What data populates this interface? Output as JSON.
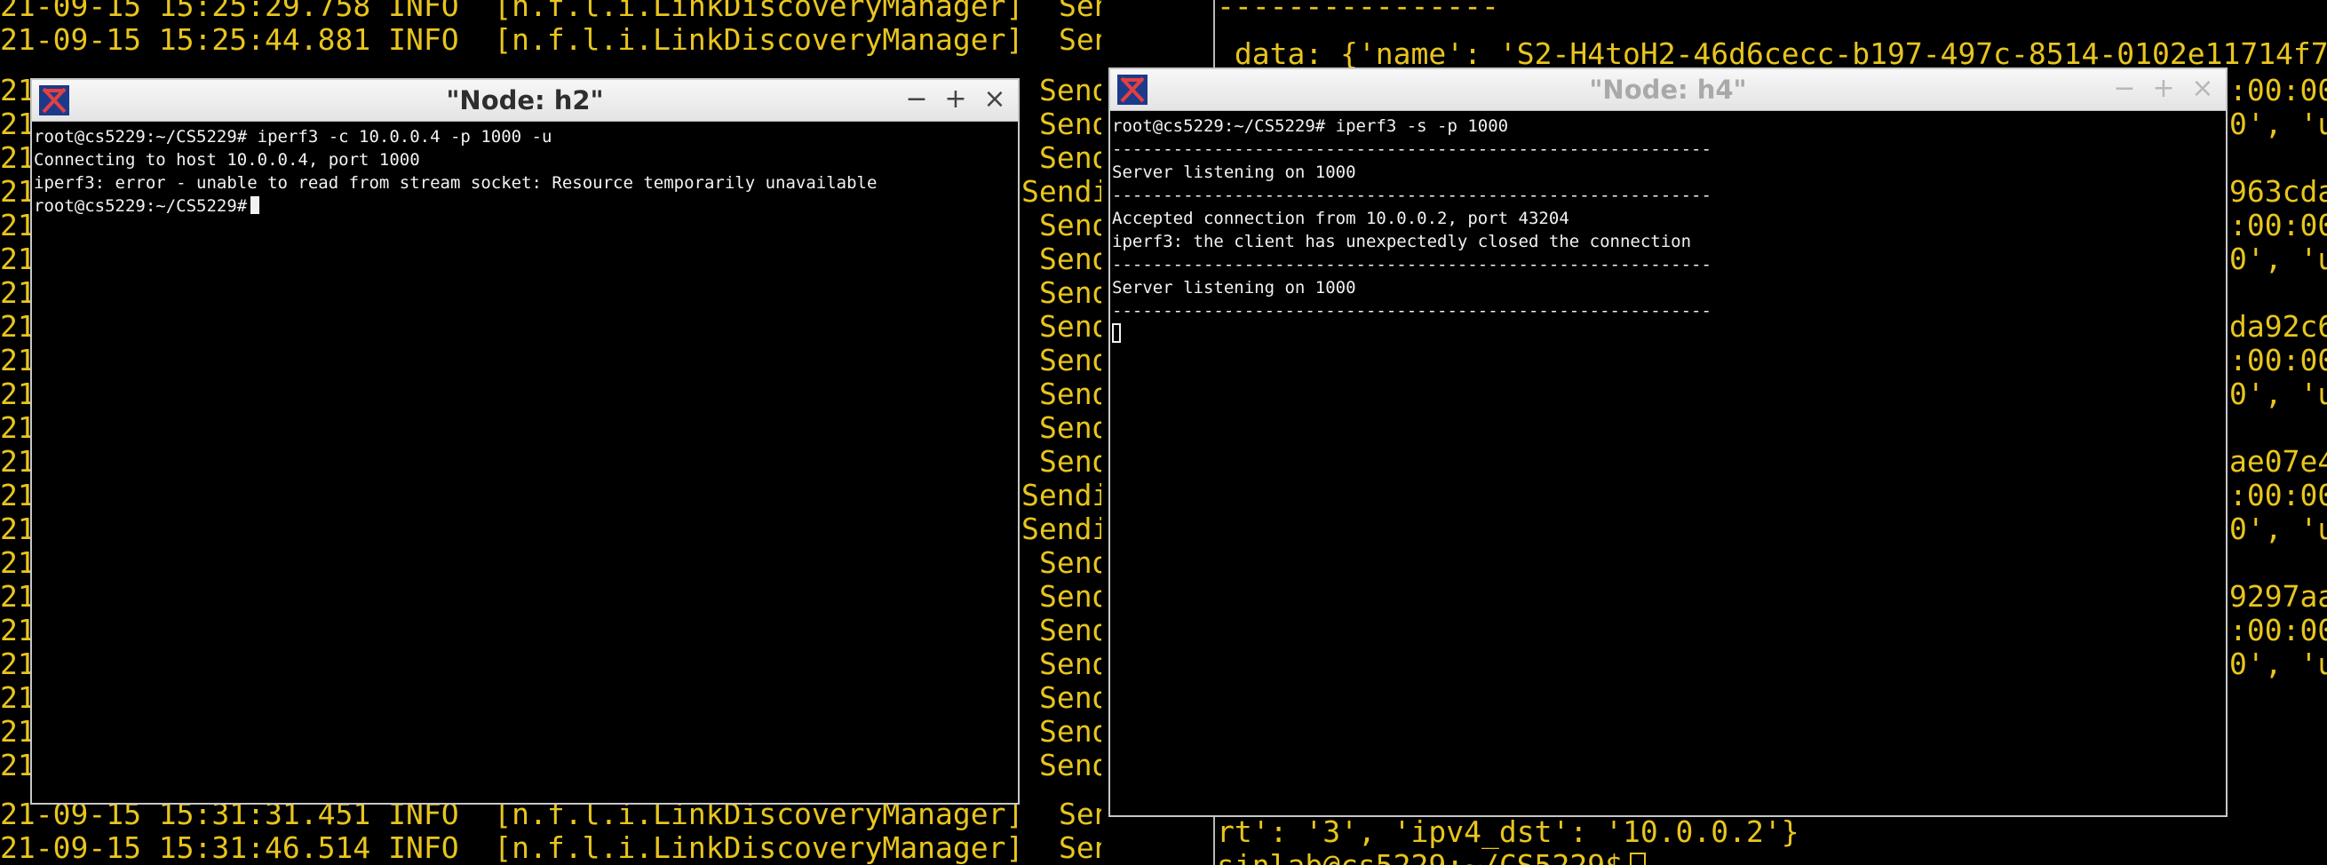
{
  "background": {
    "left_top": [
      "21-09-15 15:25:29.758 INFO  [n.f.l.i.LinkDiscoveryManager]  Sending LL",
      "21-09-15 15:25:44.881 INFO  [n.f.l.i.LinkDiscoveryManager]  Sending LL"
    ],
    "left_right_edge": [
      "Send",
      "Send",
      "Send",
      "Sendi",
      "Send",
      "Send",
      "Send",
      "Send",
      "Send",
      "Send",
      "Send",
      "Send",
      "Sendi",
      "Sendi",
      "Send",
      "Send",
      "Send",
      "Send",
      "Send",
      "Send",
      "Send"
    ],
    "left_gutter": "21",
    "left_bottom": [
      "21-09-15 15:31:31.451 INFO  [n.f.l.i.LinkDiscoveryManager]  Sending LL",
      "21-09-15 15:31:46.514 INFO  [n.f.l.i.LinkDiscoveryManager]  Sending LL"
    ],
    "right_top": [
      "----------------",
      " data: {'name': 'S2-H4toH2-46d6cecc-b197-497c-8514-0102e11714f7"
    ],
    "right_edge": [
      ":00:00",
      "0', 'u",
      "",
      "963cda",
      ":00:00",
      "0', 'u",
      "",
      "da92c6",
      ":00:00",
      "0', 'u",
      "",
      "ae07e4",
      ":00:00",
      "0', 'u",
      "",
      "9297aa",
      ":00:00",
      "0', 'u"
    ],
    "right_bottom": [
      "rt': '3', 'ipv4_dst': '10.0.0.2'}",
      "sinlab@cs5229:~/CS5229$"
    ]
  },
  "window_h2": {
    "title": "\"Node: h2\"",
    "lines": [
      "root@cs5229:~/CS5229# iperf3 -c 10.0.0.4 -p 1000 -u",
      "Connecting to host 10.0.0.4, port 1000",
      "iperf3: error - unable to read from stream socket: Resource temporarily unavailable"
    ],
    "prompt": "root@cs5229:~/CS5229#"
  },
  "window_h4": {
    "title": "\"Node: h4\"",
    "lines": [
      "root@cs5229:~/CS5229# iperf3 -s -p 1000",
      "-----------------------------------------------------------",
      "Server listening on 1000",
      "-----------------------------------------------------------",
      "Accepted connection from 10.0.0.2, port 43204",
      "iperf3: the client has unexpectedly closed the connection",
      "-----------------------------------------------------------",
      "Server listening on 1000",
      "-----------------------------------------------------------"
    ]
  },
  "window_buttons": {
    "minimize": "−",
    "maximize": "+",
    "close": "×"
  },
  "colors": {
    "terminal_bg": "#000000",
    "log_text": "#e8c51e",
    "xterm_text": "#f2f2f2",
    "titlebar": "#ececec"
  }
}
